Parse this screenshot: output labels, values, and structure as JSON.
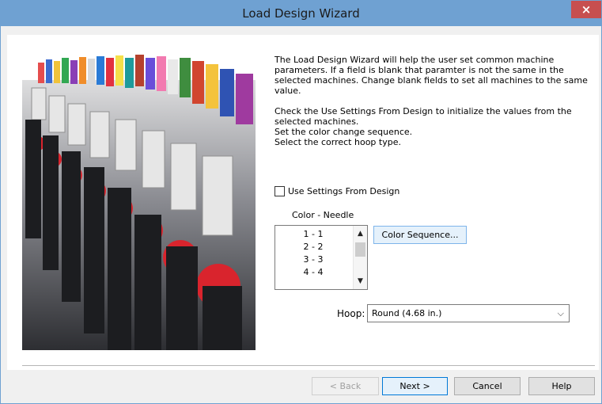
{
  "window": {
    "title": "Load Design Wizard",
    "close_label": "×"
  },
  "description": {
    "para1": "The Load Design Wizard will help the user set common machine parameters. If a field is blank that paramter is not the same in the selected machines. Change blank fields to set all machines to the same value.",
    "line1": "Check the Use Settings From Design to initialize the values from the selected machines.",
    "line2": "Set the color change sequence.",
    "line3": "Select the correct hoop type."
  },
  "use_settings": {
    "label": "Use Settings From Design",
    "checked": false
  },
  "color_needle": {
    "label": "Color - Needle",
    "rows": [
      "1 - 1",
      "2 - 2",
      "3 - 3",
      "4 - 4"
    ],
    "scroll_up_icon": "chevron-up",
    "scroll_down_icon": "chevron-down"
  },
  "color_sequence_button": "Color Sequence...",
  "hoop": {
    "label": "Hoop:",
    "value": "Round (4.68 in.)",
    "dropdown_icon": "chevron-down"
  },
  "buttons": {
    "back": "< Back",
    "next": "Next >",
    "cancel": "Cancel",
    "help": "Help"
  }
}
